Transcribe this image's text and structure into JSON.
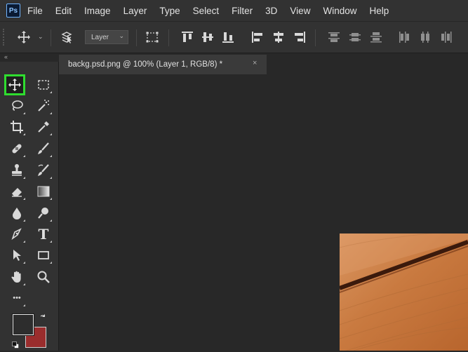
{
  "app": {
    "logo_text": "Ps"
  },
  "menu": [
    "File",
    "Edit",
    "Image",
    "Layer",
    "Type",
    "Select",
    "Filter",
    "3D",
    "View",
    "Window",
    "Help"
  ],
  "options_bar": {
    "layer_select": "Layer",
    "move_tool_icon": "move-icon",
    "auto_select_icon": "auto-select-layers-icon",
    "transform_controls_icon": "transform-controls-icon",
    "align_icons": [
      "align-top-icon",
      "align-vertical-center-icon",
      "align-bottom-icon",
      "align-left-icon",
      "align-horizontal-center-icon",
      "align-right-icon"
    ],
    "distribute_icons": [
      "distribute-top-icon",
      "distribute-vertical-center-icon",
      "distribute-bottom-icon",
      "distribute-left-icon",
      "distribute-horizontal-center-icon",
      "distribute-right-icon"
    ]
  },
  "panel_strip": {
    "collapse_glyph": "«"
  },
  "document": {
    "tab_title": "backg.psd.png @ 100% (Layer 1, RGB/8) *",
    "close_glyph": "×"
  },
  "toolbar": {
    "active_tool": "move",
    "tools": [
      "move-icon",
      "rectangular-marquee-icon",
      "lasso-icon",
      "magic-wand-icon",
      "crop-icon",
      "eyedropper-icon",
      "healing-brush-icon",
      "brush-icon",
      "clone-stamp-icon",
      "history-brush-icon",
      "eraser-icon",
      "gradient-icon",
      "blur-icon",
      "dodge-icon",
      "pen-icon",
      "type-icon",
      "path-selection-icon",
      "rectangle-icon",
      "hand-icon",
      "zoom-icon",
      "more-tools-icon"
    ],
    "type_tool_glyph": "T",
    "more_glyph": "•••",
    "foreground_color": "#2d2d2d",
    "background_color": "#9a2d2d"
  },
  "colors": {
    "accent_highlight": "#2fdd2f",
    "photo_wood": "#c8773c"
  }
}
